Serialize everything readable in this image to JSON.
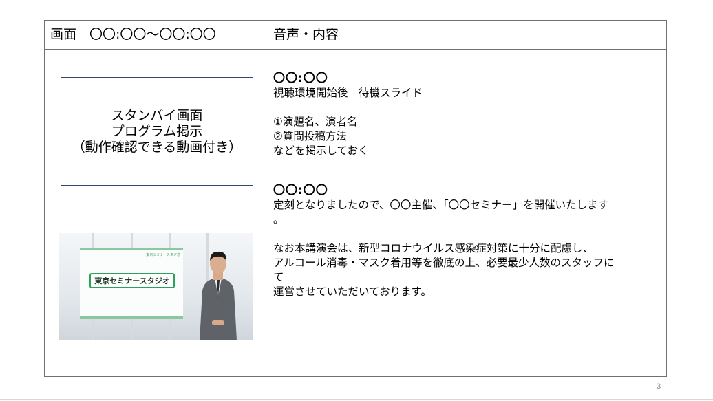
{
  "table": {
    "header_left": "画面　〇〇:〇〇～〇〇:〇〇",
    "header_right": "音声・内容"
  },
  "standby": {
    "line1": "スタンバイ画面",
    "line2": "プログラム掲示",
    "line3": "（動作確認できる動画付き）"
  },
  "thumbnail": {
    "board_title": "東京セミナースタジオ",
    "board_tag": "東京セミナースタジオ"
  },
  "content": {
    "block1": {
      "time": "〇〇:〇〇",
      "lines": [
        "視聴環境開始後　待機スライド",
        "",
        "①演題名、演者名",
        "②質問投稿方法",
        "などを掲示しておく"
      ]
    },
    "block2": {
      "time": "〇〇:〇〇",
      "lines": [
        "定刻となりましたので、〇〇主催、「〇〇セミナー」を開催いたします",
        "。",
        "",
        "なお本講演会は、新型コロナウイルス感染症対策に十分に配慮し、",
        "アルコール消毒・マスク着用等を徹底の上、必要最少人数のスタッフに",
        "て",
        "運営させていただいております。"
      ]
    }
  },
  "page_number": "3",
  "colors": {
    "border": "#707070",
    "box_border": "#2f4a7a",
    "accent_green": "#2aa35a"
  }
}
